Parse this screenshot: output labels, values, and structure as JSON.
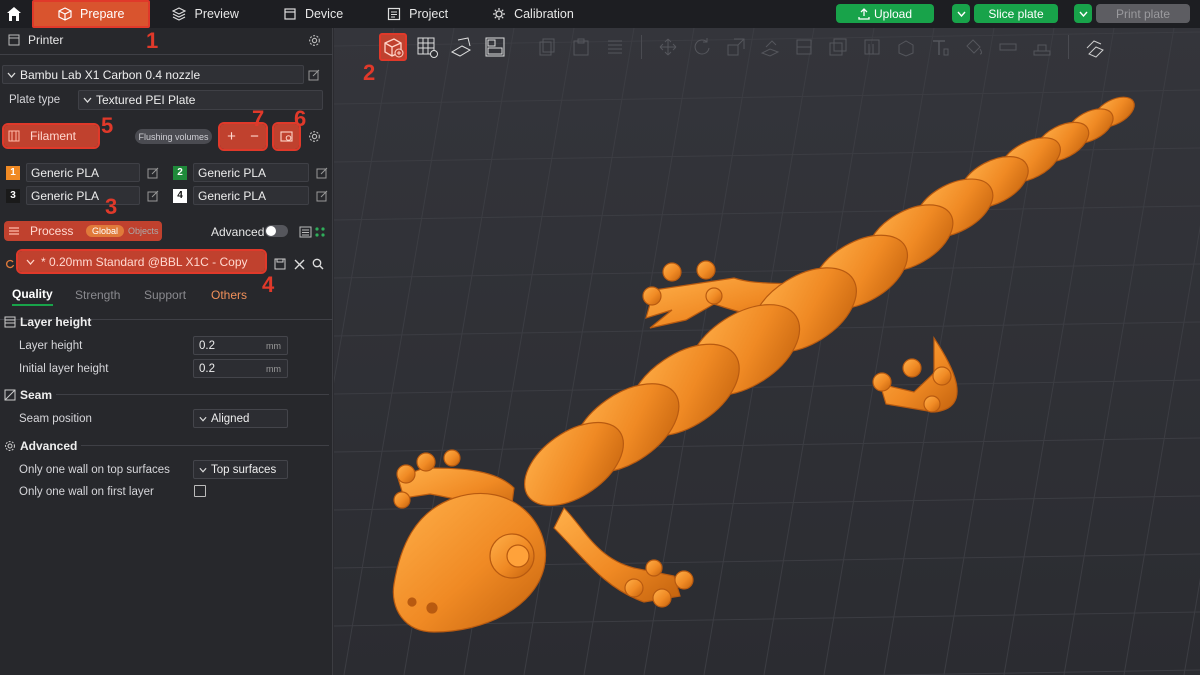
{
  "topbar": {
    "tabs": [
      {
        "label": "Prepare",
        "icon": "cube-icon"
      },
      {
        "label": "Preview",
        "icon": "layers-icon"
      },
      {
        "label": "Device",
        "icon": "device-icon"
      },
      {
        "label": "Project",
        "icon": "project-icon"
      },
      {
        "label": "Calibration",
        "icon": "calibration-icon"
      }
    ],
    "upload_label": "Upload",
    "slice_label": "Slice plate",
    "print_label": "Print plate"
  },
  "printer": {
    "section_label": "Printer",
    "name": "Bambu Lab X1 Carbon 0.4 nozzle",
    "plate_type_label": "Plate type",
    "plate_type_value": "Textured PEI Plate"
  },
  "filament": {
    "section_label": "Filament",
    "flushing_label": "Flushing volumes",
    "add_label": "+",
    "remove_label": "−",
    "slots": [
      {
        "num": "1",
        "name": "Generic PLA",
        "color": "#f08a24"
      },
      {
        "num": "2",
        "name": "Generic PLA",
        "color": "#1f8a3a"
      },
      {
        "num": "3",
        "name": "Generic PLA",
        "color": "#1a1a1a"
      },
      {
        "num": "4",
        "name": "Generic PLA",
        "color": "#ffffff"
      }
    ]
  },
  "process": {
    "section_label": "Process",
    "global_label": "Global",
    "objects_label": "Objects",
    "advanced_label": "Advanced",
    "preset": "* 0.20mm Standard @BBL X1C - Copy",
    "tabs": [
      "Quality",
      "Strength",
      "Support",
      "Others"
    ],
    "groups": {
      "layer_height": {
        "title": "Layer height",
        "layer_height_label": "Layer height",
        "layer_height_value": "0.2",
        "initial_label": "Initial layer height",
        "initial_value": "0.2",
        "unit": "mm"
      },
      "seam": {
        "title": "Seam",
        "position_label": "Seam position",
        "position_value": "Aligned"
      },
      "advanced": {
        "title": "Advanced",
        "one_wall_top_label": "Only one wall on top surfaces",
        "one_wall_top_value": "Top surfaces",
        "one_wall_first_label": "Only one wall on first layer"
      }
    }
  },
  "annotations": [
    "1",
    "2",
    "3",
    "4",
    "5",
    "6",
    "7"
  ],
  "colors": {
    "accent": "#e0392a",
    "green": "#18a34a",
    "model": "#f08a24"
  }
}
